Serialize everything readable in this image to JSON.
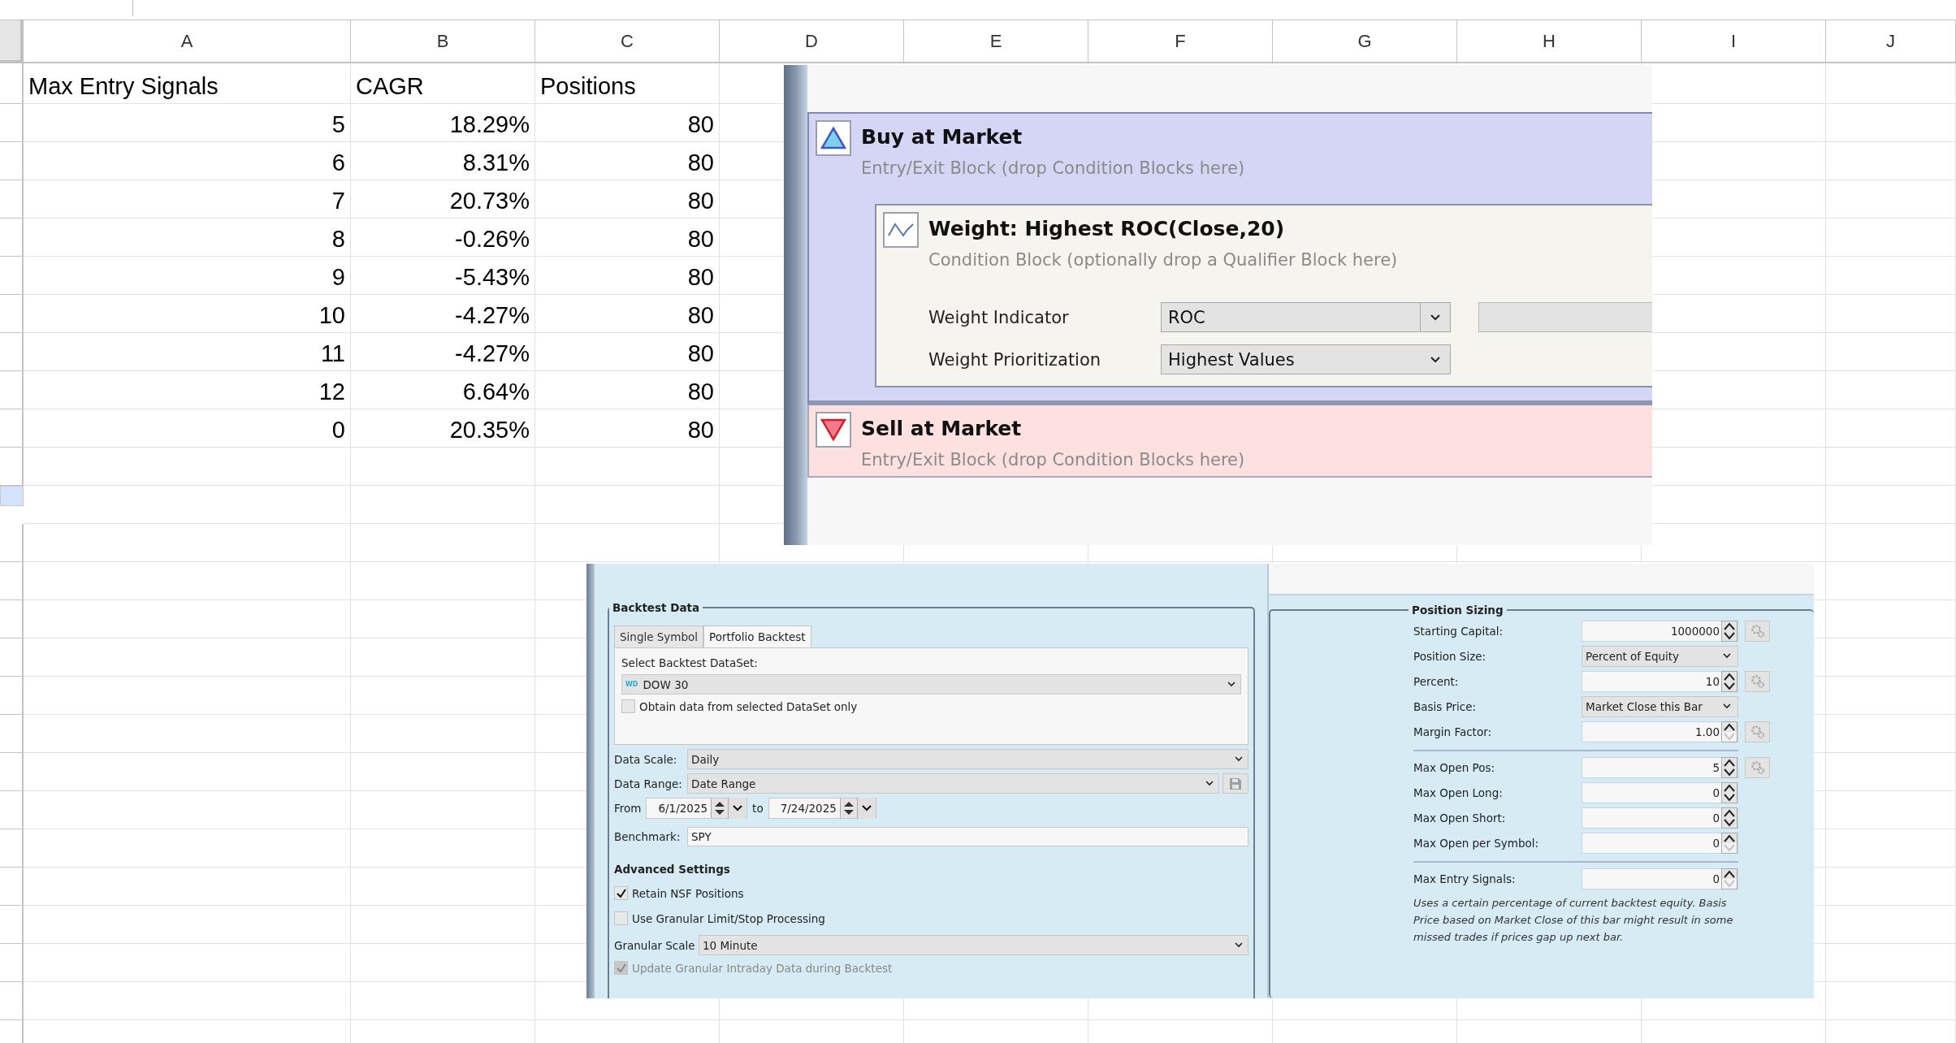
{
  "spreadsheet": {
    "columns": [
      "A",
      "B",
      "C",
      "D",
      "E",
      "F",
      "G",
      "H",
      "I",
      "J"
    ],
    "header": [
      "Max Entry Signals",
      "CAGR",
      "Positions"
    ],
    "rows": [
      [
        "5",
        "18.29%",
        "80"
      ],
      [
        "6",
        "8.31%",
        "80"
      ],
      [
        "7",
        "20.73%",
        "80"
      ],
      [
        "8",
        "-0.26%",
        "80"
      ],
      [
        "9",
        "-5.43%",
        "80"
      ],
      [
        "10",
        "-4.27%",
        "80"
      ],
      [
        "11",
        "-4.27%",
        "80"
      ],
      [
        "12",
        "6.64%",
        "80"
      ],
      [
        "0",
        "20.35%",
        "80"
      ]
    ],
    "row_headers": [
      {
        "selected": false
      },
      {
        "selected": false
      },
      {
        "selected": false
      },
      {
        "selected": false
      },
      {
        "selected": false
      },
      {
        "selected": false
      },
      {
        "selected": false
      },
      {
        "selected": false
      },
      {
        "selected": false
      },
      {
        "selected": false
      },
      {
        "selected": false
      },
      {
        "selected": true
      },
      {
        "selected": false
      },
      {
        "selected": false
      },
      {
        "selected": false
      },
      {
        "selected": false
      },
      {
        "selected": false
      },
      {
        "selected": false
      },
      {
        "selected": false
      },
      {
        "selected": false
      },
      {
        "selected": false
      },
      {
        "selected": false
      },
      {
        "selected": false
      },
      {
        "selected": false
      },
      {
        "selected": false
      },
      {
        "selected": false
      }
    ]
  },
  "strategy_blocks": [
    {
      "kind": "buy",
      "title": "Buy at Market",
      "subtitle": "Entry/Exit Block (drop Condition Blocks here)",
      "conditions": [
        {
          "title": "Weight: Highest ROC(Close,20)",
          "subtitle": "Condition Block (optionally drop a Qualifier Block here)",
          "params": [
            {
              "label": "Weight Indicator",
              "value": "ROC",
              "split_caret": true,
              "extra_field": true
            },
            {
              "label": "Weight Prioritization",
              "value": "Highest Values",
              "split_caret": false,
              "extra_field": false
            }
          ]
        }
      ]
    },
    {
      "kind": "sell",
      "title": "Sell at Market",
      "subtitle": "Entry/Exit Block (drop Condition Blocks here)"
    }
  ],
  "backtest_data": {
    "title": "Backtest Data",
    "tabs": [
      {
        "label": "Single Symbol",
        "selected": false
      },
      {
        "label": "Portfolio Backtest",
        "selected": true
      }
    ],
    "dataset_label": "Select Backtest DataSet:",
    "dataset": {
      "badge": "WD",
      "value": "DOW 30"
    },
    "dataset_only": {
      "label": "Obtain data from selected DataSet only",
      "checked": false,
      "disabled": false
    },
    "data_scale": {
      "label": "Data Scale:",
      "value": "Daily"
    },
    "data_range": {
      "label": "Data Range:",
      "value": "Date Range"
    },
    "from": {
      "label": "From",
      "value": "6/1/2025"
    },
    "to": {
      "label": "to",
      "value": "7/24/2025"
    },
    "benchmark": {
      "label": "Benchmark:",
      "value": "SPY"
    },
    "advanced_title": "Advanced Settings",
    "options": [
      {
        "label": "Retain NSF Positions",
        "checked": true,
        "disabled": false
      },
      {
        "label": "Use Granular Limit/Stop Processing",
        "checked": false,
        "disabled": false
      }
    ],
    "granular_scale": {
      "label": "Granular Scale",
      "value": "10 Minute"
    },
    "options_2": [
      {
        "label": "Update Granular Intraday Data during Backtest",
        "checked": true,
        "disabled": true
      }
    ]
  },
  "position_sizing": {
    "title": "Position Sizing",
    "rows": [
      {
        "kind": "spin",
        "label": "Starting Capital:",
        "value": "1000000",
        "gear": true,
        "down_disabled": false
      },
      {
        "kind": "select",
        "label": "Position Size:",
        "value": "Percent of Equity"
      },
      {
        "kind": "spin",
        "label": "Percent:",
        "value": "10",
        "gear": true,
        "down_disabled": false
      },
      {
        "kind": "select",
        "label": "Basis Price:",
        "value": "Market Close this Bar"
      },
      {
        "kind": "spin",
        "label": "Margin Factor:",
        "value": "1.00",
        "gear": true,
        "down_disabled": true
      },
      {
        "kind": "separator"
      },
      {
        "kind": "spin",
        "label": "Max Open Pos:",
        "value": "5",
        "gear": true,
        "down_disabled": false
      },
      {
        "kind": "spin",
        "label": "Max Open Long:",
        "value": "0",
        "gear": false,
        "down_disabled": false
      },
      {
        "kind": "spin",
        "label": "Max Open Short:",
        "value": "0",
        "gear": false,
        "down_disabled": false
      },
      {
        "kind": "spin",
        "label": "Max Open per Symbol:",
        "value": "0",
        "gear": false,
        "down_disabled": true
      },
      {
        "kind": "separator"
      },
      {
        "kind": "spin",
        "label": "Max Entry Signals:",
        "value": "0",
        "gear": false,
        "down_disabled": true
      }
    ],
    "note": "Uses a certain percentage of current backtest equity. Basis Price based on Market Close of this bar might result in some missed trades if prices gap up next bar."
  }
}
